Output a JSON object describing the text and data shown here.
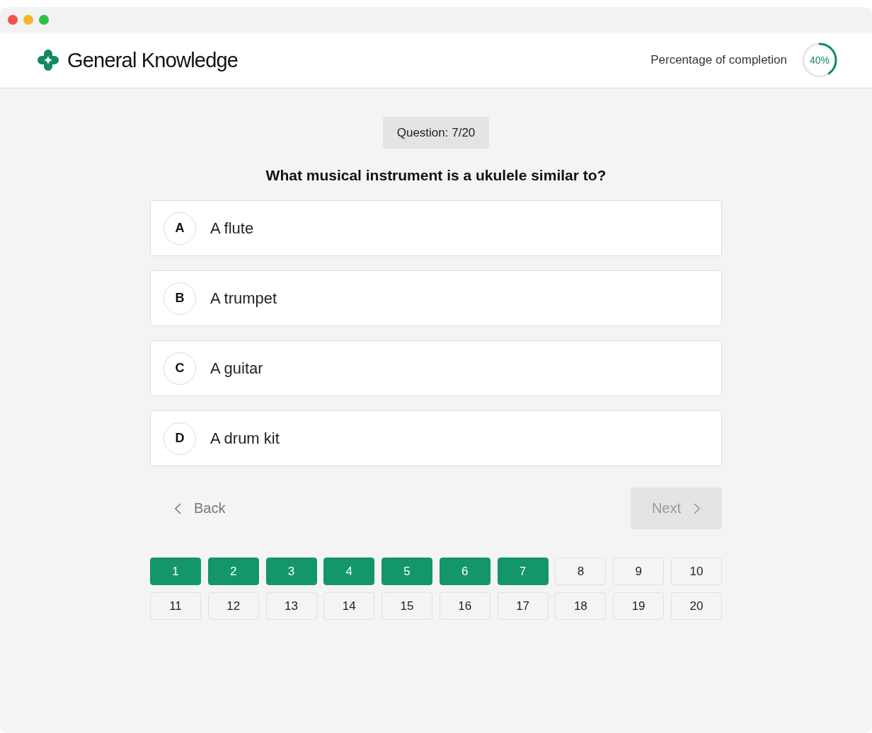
{
  "app": {
    "title": "General Knowledge"
  },
  "progress": {
    "label": "Percentage of completion",
    "reading": "40%"
  },
  "question": {
    "counter_label": "Question:",
    "counter": "7/20",
    "text": "What musical instrument is a ukulele similar to?"
  },
  "options": [
    {
      "letter": "A",
      "text": "A flute",
      "selected": false
    },
    {
      "letter": "B",
      "text": "A trumpet",
      "selected": false
    },
    {
      "letter": "C",
      "text": "A guitar",
      "selected": false
    },
    {
      "letter": "D",
      "text": "A drum kit",
      "selected": false
    }
  ],
  "navigation": {
    "back": {
      "label": "Back",
      "disabled": false
    },
    "next": {
      "label": "Next",
      "disabled": true
    }
  },
  "question_numbers": [
    {
      "label": "1",
      "answered": true
    },
    {
      "label": "2",
      "answered": true
    },
    {
      "label": "3",
      "answered": true
    },
    {
      "label": "4",
      "answered": true
    },
    {
      "label": "5",
      "answered": true
    },
    {
      "label": "6",
      "answered": true
    },
    {
      "label": "7",
      "answered": true
    },
    {
      "label": "8",
      "answered": false
    },
    {
      "label": "9",
      "answered": false
    },
    {
      "label": "10",
      "answered": false
    },
    {
      "label": "11",
      "answered": false
    },
    {
      "label": "12",
      "answered": false
    },
    {
      "label": "13",
      "answered": false
    },
    {
      "label": "14",
      "answered": false
    },
    {
      "label": "15",
      "answered": false
    },
    {
      "label": "16",
      "answered": false
    },
    {
      "label": "17",
      "answered": false
    },
    {
      "label": "18",
      "answered": false
    },
    {
      "label": "19",
      "answered": false
    },
    {
      "label": "20",
      "answered": false
    }
  ]
}
